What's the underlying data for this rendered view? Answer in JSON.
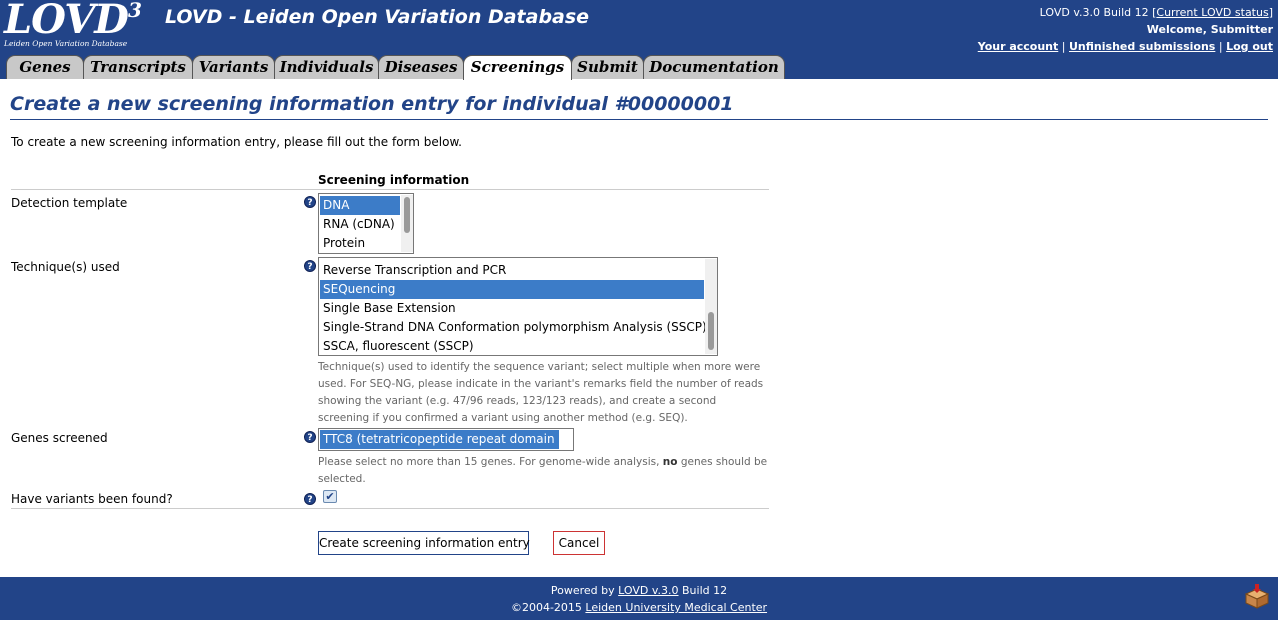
{
  "header": {
    "logo_text": "LOVD",
    "logo_version": "3",
    "logo_subtitle": "Leiden Open Variation Database",
    "app_title": "LOVD - Leiden Open Variation Database",
    "version_text": "LOVD v.3.0 Build 12 [",
    "version_link": "Current LOVD status",
    "version_close": "]",
    "welcome": "Welcome, Submitter",
    "your_account": "Your account",
    "unfinished": "Unfinished submissions",
    "logout": "Log out",
    "sep": "|"
  },
  "tabs": [
    "Genes",
    "Transcripts",
    "Variants",
    "Individuals",
    "Diseases",
    "Screenings",
    "Submit",
    "Documentation"
  ],
  "active_tab": "Screenings",
  "page": {
    "title": "Create a new screening information entry for individual #00000001",
    "intro": "To create a new screening information entry, please fill out the form below."
  },
  "form": {
    "section_title": "Screening information",
    "detection_label": "Detection template",
    "detection_options": [
      {
        "label": "DNA",
        "selected": true
      },
      {
        "label": "RNA (cDNA)",
        "selected": false
      },
      {
        "label": "Protein",
        "selected": false
      }
    ],
    "technique_label": "Technique(s) used",
    "technique_options": [
      {
        "label": "Reverse Transcription and PCR",
        "selected": false
      },
      {
        "label": "SEQuencing",
        "selected": true
      },
      {
        "label": "Single Base Extension",
        "selected": false
      },
      {
        "label": "Single-Strand DNA Conformation polymorphism Analysis (SSCP)",
        "selected": false
      },
      {
        "label": "SSCA, fluorescent (SSCP)",
        "selected": false
      }
    ],
    "technique_hint": "Technique(s) used to identify the sequence variant; select multiple when more were used. For SEQ-NG, please indicate in the variant's remarks field the number of reads showing the variant (e.g. 47/96 reads, 123/123 reads), and create a second screening if you confirmed a variant using another method (e.g. SEQ).",
    "genes_label": "Genes screened",
    "genes_selected": "TTC8 (tetratricopeptide repeat domain 8)",
    "genes_hint_pre": "Please select no more than 15 genes. For genome-wide analysis,",
    "genes_hint_bold": "no",
    "genes_hint_post": "genes should be selected.",
    "variants_found_label": "Have variants been found?",
    "variants_found_checked": true,
    "help_glyph": "?",
    "submit_label": "Create screening information entry",
    "cancel_label": "Cancel"
  },
  "footer": {
    "powered_pre": "Powered by",
    "powered_link": "LOVD v.3.0",
    "powered_post": "Build 12",
    "copyright_pre": "©2004-2015",
    "copyright_link": "Leiden University Medical Center"
  },
  "colors": {
    "brand": "#224488",
    "selection": "#3c7cc8"
  }
}
